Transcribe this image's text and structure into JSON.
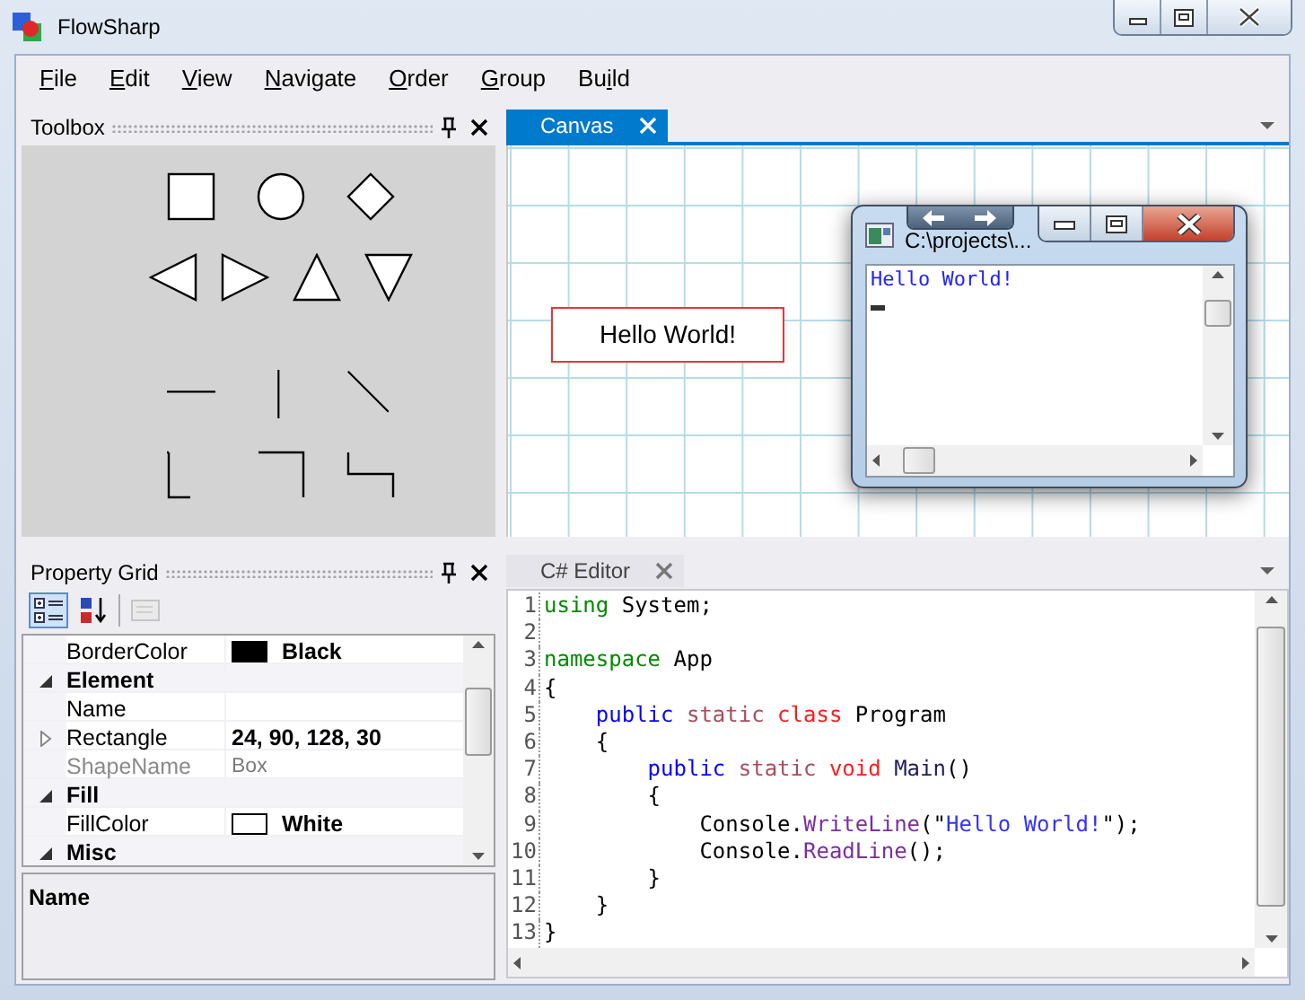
{
  "window": {
    "title": "FlowSharp"
  },
  "menu": [
    {
      "access_key": "F",
      "text_after": "ile"
    },
    {
      "access_key": "E",
      "text_after": "dit"
    },
    {
      "access_key": "V",
      "text_after": "iew"
    },
    {
      "access_key": "N",
      "text_after": "avigate"
    },
    {
      "access_key": "O",
      "text_after": "rder"
    },
    {
      "access_key": "G",
      "text_after": "roup"
    },
    {
      "text_before": "Bu",
      "access_key": "i",
      "text_after": "ld"
    }
  ],
  "toolbox": {
    "title": "Toolbox",
    "rows": [
      [
        {
          "kind": "square"
        },
        {
          "kind": "circle"
        },
        {
          "kind": "diamond"
        }
      ],
      [
        {
          "kind": "triangle-left"
        },
        {
          "kind": "triangle-right"
        },
        {
          "kind": "triangle-up"
        },
        {
          "kind": "triangle-down"
        }
      ],
      [
        {
          "kind": "line-horizontal"
        },
        {
          "kind": "line-vertical"
        },
        {
          "kind": "line-diagonal"
        }
      ],
      [
        {
          "kind": "step-down"
        },
        {
          "kind": "corner"
        },
        {
          "kind": "step-across"
        }
      ]
    ]
  },
  "canvas": {
    "tab": {
      "label": "Canvas",
      "selected": true
    },
    "shapes": [
      {
        "kind": "box",
        "text": "Hello World!"
      }
    ]
  },
  "console_window": {
    "title": "C:\\projects\\...",
    "lines": [
      "Hello World!"
    ]
  },
  "property_grid": {
    "title": "Property Grid",
    "toolbar": [
      {
        "kind": "categorized",
        "selected": true,
        "disabled": false
      },
      {
        "kind": "alphabetical",
        "selected": false,
        "disabled": false
      },
      {
        "kind": "property-pages",
        "selected": false,
        "disabled": true
      }
    ],
    "rows": [
      {
        "kind": "property",
        "name": "BorderColor",
        "value": "Black",
        "color": "#000000",
        "readonly": false
      },
      {
        "kind": "category",
        "name": "Element",
        "expanded": true
      },
      {
        "kind": "property",
        "name": "Name",
        "readonly": false
      },
      {
        "kind": "property",
        "name": "Rectangle",
        "value": "24, 90, 128, 30",
        "expanded": false,
        "readonly": false
      },
      {
        "kind": "property",
        "name": "ShapeName",
        "value": "Box",
        "readonly": true
      },
      {
        "kind": "category",
        "name": "Fill",
        "expanded": true
      },
      {
        "kind": "property",
        "name": "FillColor",
        "value": "White",
        "color": "#ffffff",
        "readonly": false
      },
      {
        "kind": "category",
        "name": "Misc",
        "expanded": true
      }
    ],
    "description": {
      "title": "Name"
    }
  },
  "editor": {
    "tab": {
      "label": "C# Editor",
      "selected": false
    },
    "lines": [
      {
        "number": "1",
        "tokens": [
          {
            "kind": "directive",
            "text": "using"
          },
          {
            "kind": "plain",
            "text": " System;"
          }
        ]
      },
      {
        "number": "2"
      },
      {
        "number": "3",
        "tokens": [
          {
            "kind": "directive",
            "text": "namespace"
          },
          {
            "kind": "plain",
            "text": " App"
          }
        ]
      },
      {
        "number": "4",
        "tokens": [
          {
            "kind": "plain",
            "text": "{"
          }
        ]
      },
      {
        "number": "5",
        "tokens": [
          {
            "kind": "access",
            "text": "    public"
          },
          {
            "kind": "modifier",
            "text": " static"
          },
          {
            "kind": "keyword",
            "text": " class"
          },
          {
            "kind": "plain",
            "text": " Program"
          }
        ]
      },
      {
        "number": "6",
        "tokens": [
          {
            "kind": "plain",
            "text": "    {"
          }
        ]
      },
      {
        "number": "7",
        "tokens": [
          {
            "kind": "access",
            "text": "        public"
          },
          {
            "kind": "modifier",
            "text": " static"
          },
          {
            "kind": "keyword",
            "text": " void"
          },
          {
            "kind": "name",
            "text": " Main"
          },
          {
            "kind": "plain",
            "text": "()"
          }
        ]
      },
      {
        "number": "8",
        "tokens": [
          {
            "kind": "plain",
            "text": "        {"
          }
        ]
      },
      {
        "number": "9",
        "tokens": [
          {
            "kind": "plain",
            "text": "            Console."
          },
          {
            "kind": "method",
            "text": "WriteLine"
          },
          {
            "kind": "plain",
            "text": "(\""
          },
          {
            "kind": "string",
            "text": "Hello World!"
          },
          {
            "kind": "plain",
            "text": "\");"
          }
        ]
      },
      {
        "number": "10",
        "tokens": [
          {
            "kind": "plain",
            "text": "            Console."
          },
          {
            "kind": "method",
            "text": "ReadLine"
          },
          {
            "kind": "plain",
            "text": "();"
          }
        ]
      },
      {
        "number": "11",
        "tokens": [
          {
            "kind": "plain",
            "text": "        }"
          }
        ]
      },
      {
        "number": "12",
        "tokens": [
          {
            "kind": "plain",
            "text": "    }"
          }
        ]
      },
      {
        "number": "13",
        "tokens": [
          {
            "kind": "plain",
            "text": "}"
          }
        ]
      }
    ]
  }
}
